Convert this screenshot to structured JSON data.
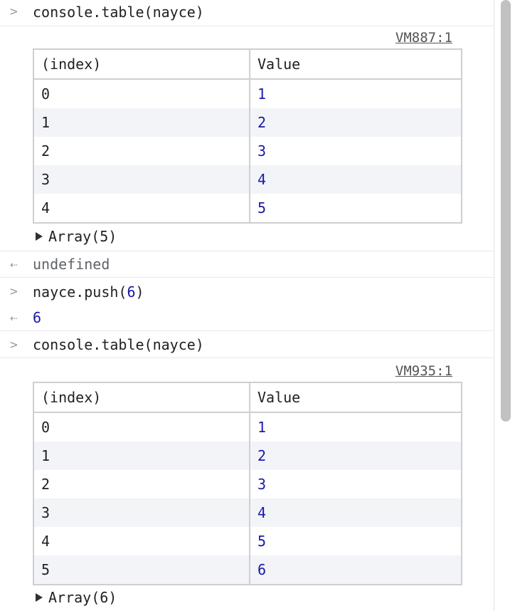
{
  "entries": {
    "cmd1": "console.table(nayce)",
    "source1": "VM887:1",
    "table1": {
      "headers": [
        "(index)",
        "Value"
      ],
      "rows": [
        [
          "0",
          "1"
        ],
        [
          "1",
          "2"
        ],
        [
          "2",
          "3"
        ],
        [
          "3",
          "4"
        ],
        [
          "4",
          "5"
        ]
      ]
    },
    "array1": "Array(5)",
    "result1": "undefined",
    "cmd2_prefix": "nayce.push(",
    "cmd2_arg": "6",
    "cmd2_suffix": ")",
    "result2": "6",
    "cmd3": "console.table(nayce)",
    "source2": "VM935:1",
    "table2": {
      "headers": [
        "(index)",
        "Value"
      ],
      "rows": [
        [
          "0",
          "1"
        ],
        [
          "1",
          "2"
        ],
        [
          "2",
          "3"
        ],
        [
          "3",
          "4"
        ],
        [
          "4",
          "5"
        ],
        [
          "5",
          "6"
        ]
      ]
    },
    "array2": "Array(6)"
  },
  "icons": {
    "input_prompt": "chevron-right-icon",
    "result_prompt": "return-arrow-icon",
    "expand": "triangle-right-icon"
  }
}
